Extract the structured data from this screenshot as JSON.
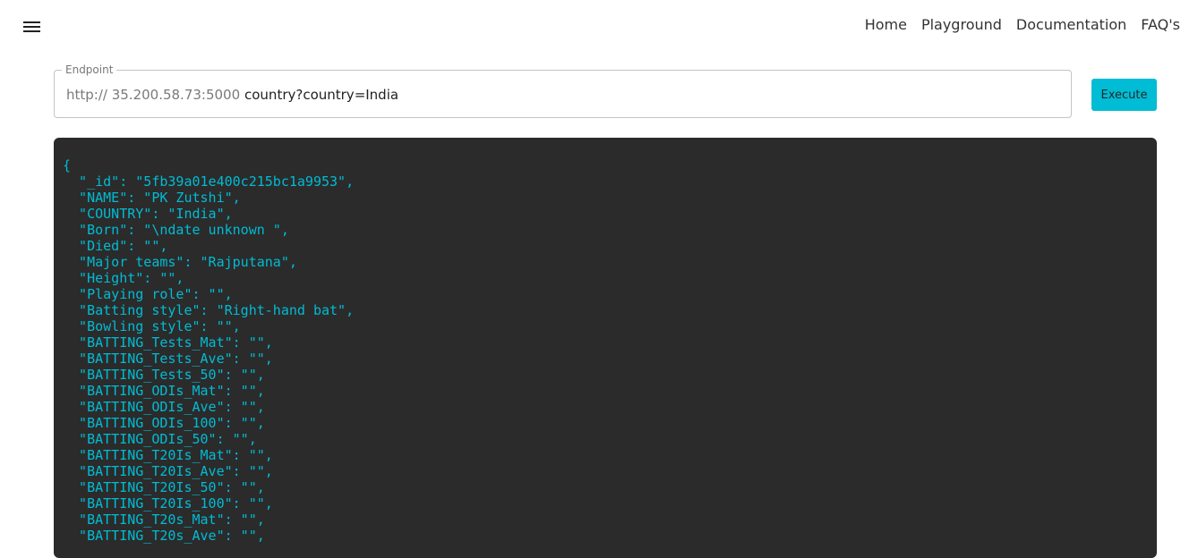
{
  "nav": {
    "menu_icon": "hamburger-menu-icon",
    "links": [
      "Home",
      "Playground",
      "Documentation",
      "FAQ's"
    ]
  },
  "endpoint": {
    "legend": "Endpoint",
    "prefix": "http:// 35.200.58.73:5000",
    "value": "country?country=India"
  },
  "execute_label": "Execute",
  "colors": {
    "accent": "#00bcd4",
    "panel_bg": "#2b2b2b"
  },
  "output": {
    "lines": [
      "{",
      "  \"_id\": \"5fb39a01e400c215bc1a9953\",",
      "  \"NAME\": \"PK Zutshi\",",
      "  \"COUNTRY\": \"India\",",
      "  \"Born\": \"\\ndate unknown \",",
      "  \"Died\": \"\",",
      "  \"Major teams\": \"Rajputana\",",
      "  \"Height\": \"\",",
      "  \"Playing role\": \"\",",
      "  \"Batting style\": \"Right-hand bat\",",
      "  \"Bowling style\": \"\",",
      "  \"BATTING_Tests_Mat\": \"\",",
      "  \"BATTING_Tests_Ave\": \"\",",
      "  \"BATTING_Tests_50\": \"\",",
      "  \"BATTING_ODIs_Mat\": \"\",",
      "  \"BATTING_ODIs_Ave\": \"\",",
      "  \"BATTING_ODIs_100\": \"\",",
      "  \"BATTING_ODIs_50\": \"\",",
      "  \"BATTING_T20Is_Mat\": \"\",",
      "  \"BATTING_T20Is_Ave\": \"\",",
      "  \"BATTING_T20Is_50\": \"\",",
      "  \"BATTING_T20Is_100\": \"\",",
      "  \"BATTING_T20s_Mat\": \"\",",
      "  \"BATTING_T20s_Ave\": \"\","
    ]
  }
}
